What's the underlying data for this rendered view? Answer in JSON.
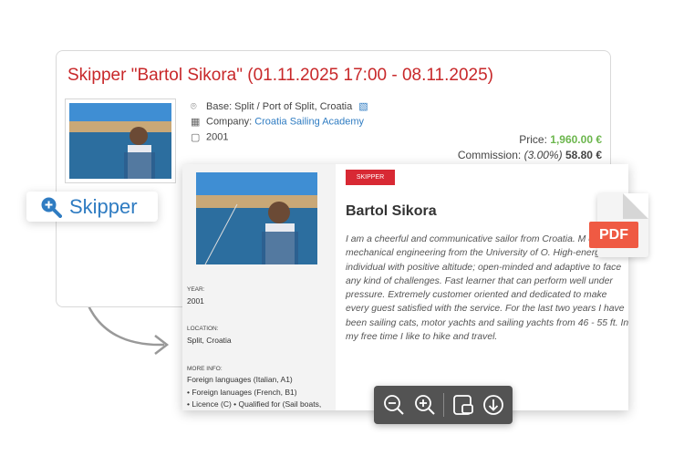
{
  "back_card": {
    "title": "Skipper \"Bartol Sikora\" (01.11.2025 17:00 - 08.11.2025)",
    "base_label": "Base: Split / Port of Split,  Croatia",
    "company_label": "Company: ",
    "company_link": "Croatia Sailing Academy",
    "year": "2001",
    "price_label": "Price: ",
    "price_value": "1,960.00 €",
    "commission_label": "Commission: ",
    "commission_pct": "(3.00%)",
    "commission_value": "58.80 €"
  },
  "pill": {
    "label": "Skipper"
  },
  "front_card": {
    "badge": "SKIPPER",
    "name": "Bartol Sikora",
    "bio": "I am a cheerful and communicative sailor from Croatia. M degree of mechanical engineering from the University of O. High-energy individual with positive altitude; open-minded and adaptive to face any kind of challenges. Fast learner that can perform well under pressure. Extremely customer oriented and dedicated to make every guest satisfied with the service. For the last two years I have been sailing cats, motor yachts and sailing yachts from 46 - 55 ft. In my free time I like to hike and travel.",
    "year_label": "YEAR:",
    "year_value": "2001",
    "location_label": "LOCATION:",
    "location_value": "Split, Croatia",
    "more_label": "MORE INFO:",
    "more_lines": [
      "Foreign languages (Italian, A1)",
      "• Foreign lanuages (French, B1)",
      "• Licence (C) • Qualified for (Sail boats,"
    ]
  },
  "pdf": {
    "label": "PDF"
  },
  "toolbar": {
    "icons": [
      "zoom-out-icon",
      "zoom-in-icon",
      "fit-page-icon",
      "download-icon"
    ]
  },
  "colors": {
    "title_red": "#c8282a",
    "link_blue": "#2f7cc2",
    "price_green": "#6cb64d",
    "badge_red": "#d82934",
    "pdf_orange": "#ef5a43",
    "toolbar": "#535353"
  }
}
